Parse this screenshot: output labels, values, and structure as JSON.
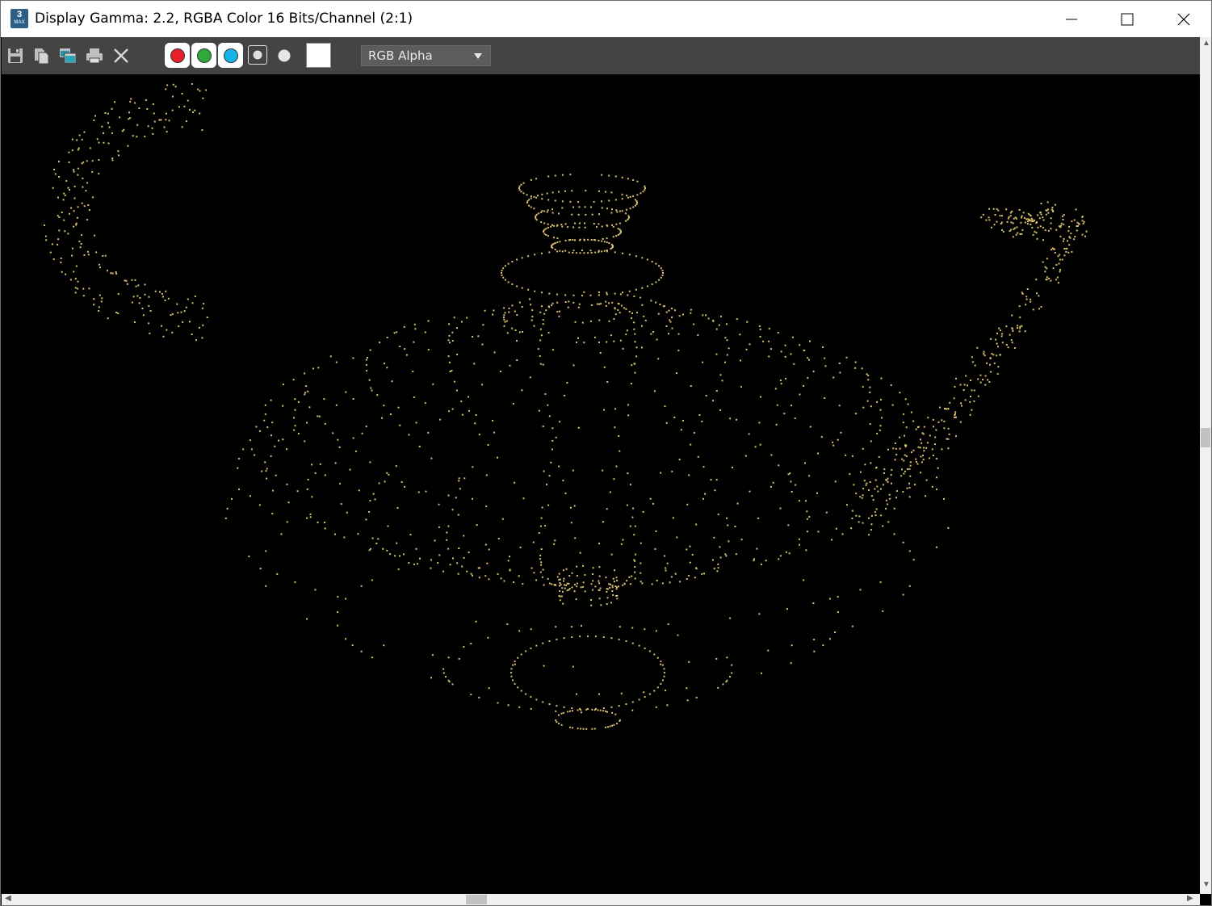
{
  "window": {
    "app_icon": {
      "number": "3",
      "caption": "MAX"
    },
    "title": "Display Gamma: 2.2, RGBA Color 16 Bits/Channel (2:1)",
    "minimize_icon": "minimize-icon",
    "maximize_icon": "maximize-icon",
    "close_icon": "close-icon"
  },
  "toolbar": {
    "buttons": [
      "save-icon",
      "copy-icon",
      "clone-window-icon",
      "print-icon",
      "clear-icon"
    ],
    "channels": [
      {
        "name": "red-channel",
        "color": "#e8202a"
      },
      {
        "name": "green-channel",
        "color": "#2eaa3a"
      },
      {
        "name": "blue-channel",
        "color": "#16b4e8"
      }
    ],
    "swatch_color": "#ffffff",
    "channel_display": {
      "selected": "RGB Alpha"
    }
  },
  "viewport": {
    "background": "#000000",
    "point_color": "#d9c070",
    "content": "teapot-point-cloud"
  }
}
